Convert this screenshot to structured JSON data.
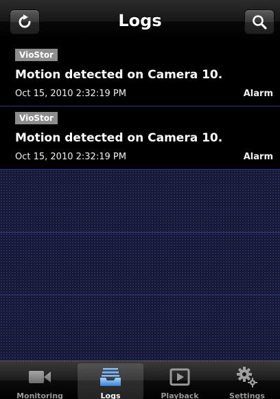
{
  "navbar": {
    "title": "Logs",
    "left_icon": "refresh-icon",
    "right_icon": "search-icon"
  },
  "logs": [
    {
      "source": "VioStor",
      "message": "Motion detected on Camera 10.",
      "datetime": "Oct 15, 2010 2:32:19 PM",
      "type": "Alarm"
    },
    {
      "source": "VioStor",
      "message": "Motion detected on Camera 10.",
      "datetime": "Oct 15, 2010 2:32:19 PM",
      "type": "Alarm"
    }
  ],
  "tabbar": {
    "tabs": [
      {
        "label": "Monitoring",
        "icon": "video-camera-icon",
        "selected": false
      },
      {
        "label": "Logs",
        "icon": "logs-tray-icon",
        "selected": true
      },
      {
        "label": "Playback",
        "icon": "playback-icon",
        "selected": false
      },
      {
        "label": "Settings",
        "icon": "gears-icon",
        "selected": false
      }
    ]
  },
  "colors": {
    "badge_bg": "#8d8d8d",
    "divider": "#253a84",
    "content_bg": "#0e1027",
    "tab_label_inactive": "#9a9a9a",
    "tab_label_active": "#ffffff",
    "tab_icon_active": "#5b9bd5"
  }
}
